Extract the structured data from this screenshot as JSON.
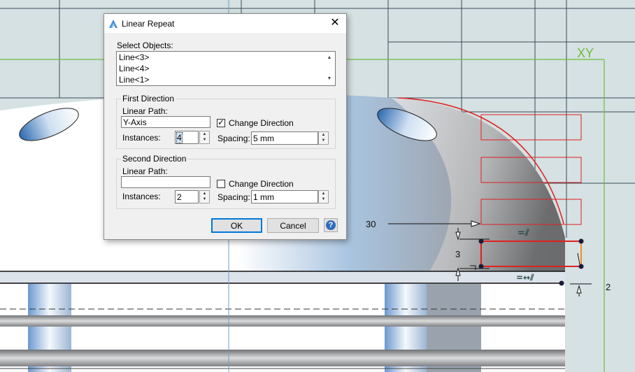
{
  "dialog": {
    "title": "Linear Repeat",
    "close_glyph": "✕",
    "icon": "app-logo-icon",
    "select_objects_label": "Select Objects:",
    "objects": [
      "Line<3>",
      "Line<4>",
      "Line<1>"
    ],
    "first_direction": {
      "group_title": "First Direction",
      "linear_path_label": "Linear Path:",
      "linear_path_value": "Y-Axis",
      "change_direction_label": "Change Direction",
      "change_direction_checked": true,
      "instances_label": "Instances:",
      "instances_value": "4",
      "spacing_label": "Spacing:",
      "spacing_value": "5 mm"
    },
    "second_direction": {
      "group_title": "Second Direction",
      "linear_path_label": "Linear Path:",
      "linear_path_value": "",
      "change_direction_label": "Change Direction",
      "change_direction_checked": false,
      "instances_label": "Instances:",
      "instances_value": "2",
      "spacing_label": "Spacing:",
      "spacing_value": "1 mm"
    },
    "ok_label": "OK",
    "cancel_label": "Cancel",
    "help_glyph": "?"
  },
  "canvas": {
    "axis_label": "XY",
    "dimension_30": "30",
    "dimension_3": "3",
    "dimension_2": "2",
    "constraint_parallel": "=⫽",
    "constraint_distance": "=↔⫽",
    "colors": {
      "grid_background": "#d5e1e2",
      "grid_lines": "#3c4a5a",
      "sketch_green": "#6bbf3a",
      "selected_red": "#e02020",
      "accent_blue": "#0078d7"
    }
  }
}
